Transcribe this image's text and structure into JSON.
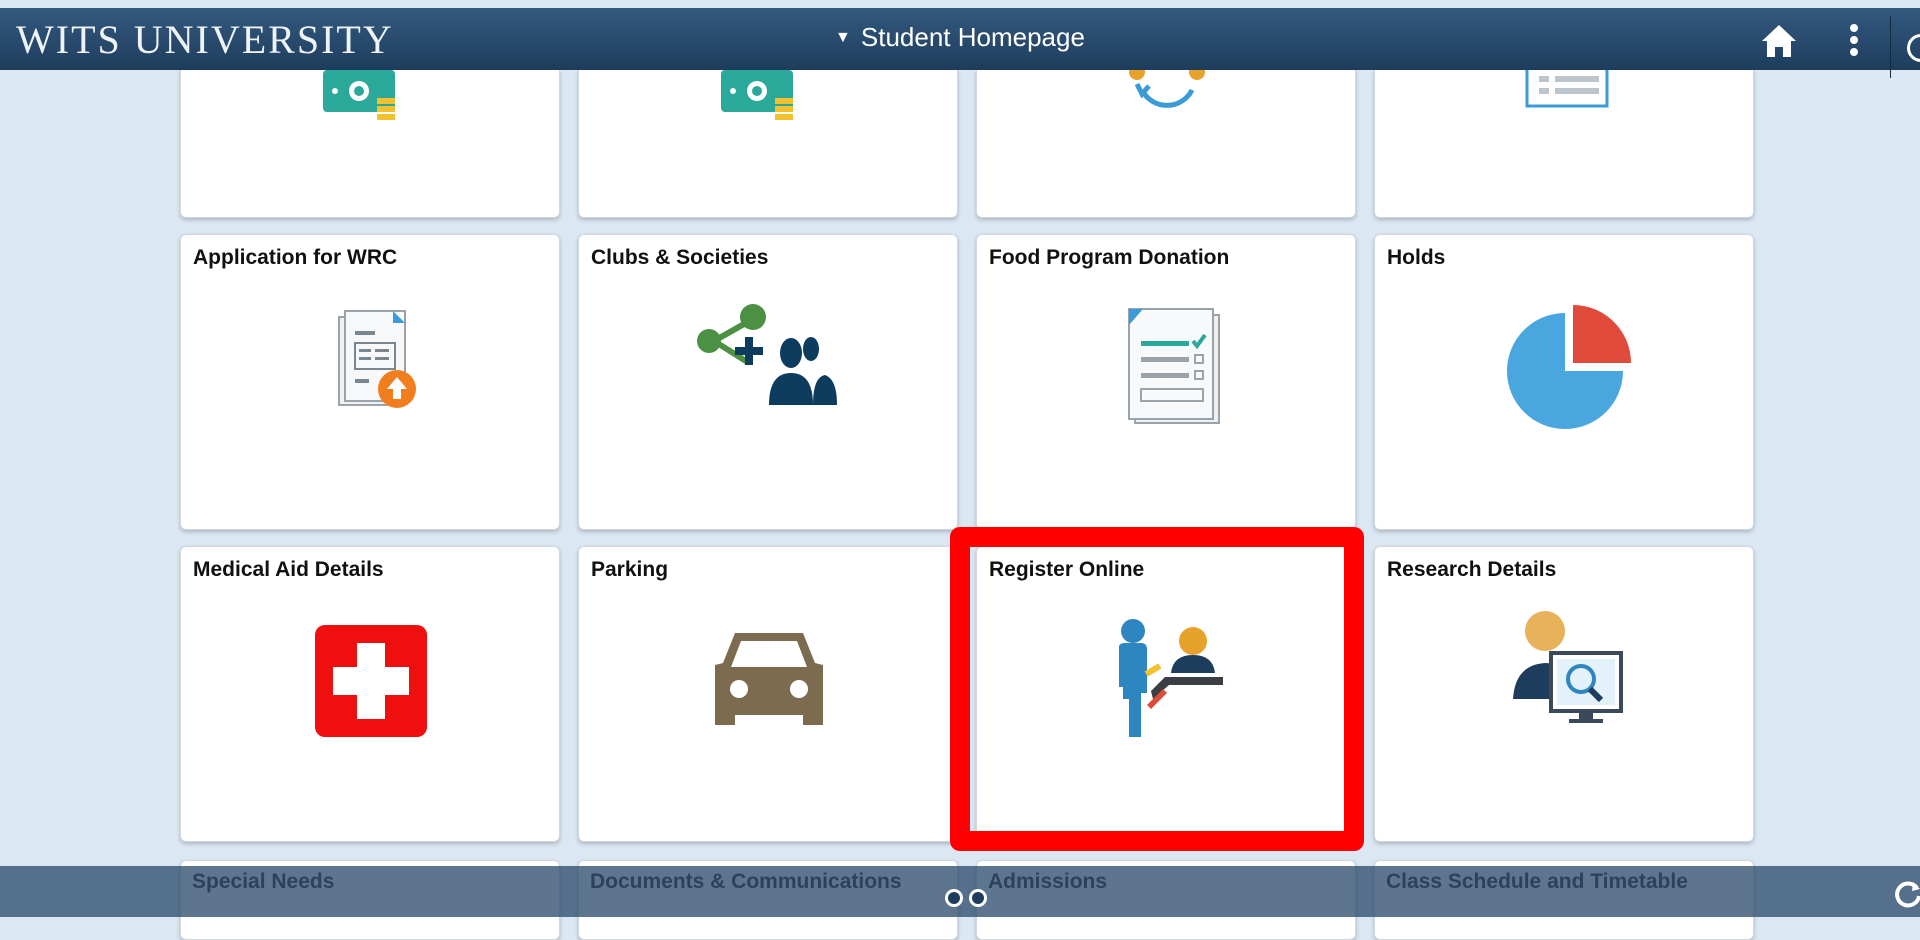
{
  "header": {
    "brand": "WITS UNIVERSITY",
    "title": "Student Homepage",
    "home_icon": "home-icon",
    "actions_icon": "vertical-dots-icon"
  },
  "tiles_top_partial": [
    {
      "icon": "money-icon"
    },
    {
      "icon": "money-icon"
    },
    {
      "icon": "people-exchange-icon"
    },
    {
      "icon": "list-icon"
    }
  ],
  "tiles": [
    {
      "label": "Application for WRC",
      "icon": "document-upload-icon"
    },
    {
      "label": "Clubs & Societies",
      "icon": "share-people-icon"
    },
    {
      "label": "Food Program Donation",
      "icon": "checklist-document-icon"
    },
    {
      "label": "Holds",
      "icon": "pie-chart-icon"
    },
    {
      "label": "Medical Aid Details",
      "icon": "medical-cross-icon"
    },
    {
      "label": "Parking",
      "icon": "car-icon"
    },
    {
      "label": "Register Online",
      "icon": "registration-desk-icon"
    },
    {
      "label": "Research Details",
      "icon": "person-magnifier-icon"
    }
  ],
  "tiles_bottom_partial": [
    {
      "label": "Special Needs"
    },
    {
      "label": "Documents & Communications"
    },
    {
      "label": "Admissions"
    },
    {
      "label": "Class Schedule and Timetable"
    }
  ],
  "pagination": {
    "pages": 2,
    "active": 1
  },
  "colors": {
    "header": "#1e3d5c",
    "background": "#dbe8f3",
    "highlight": "#ff0000"
  }
}
